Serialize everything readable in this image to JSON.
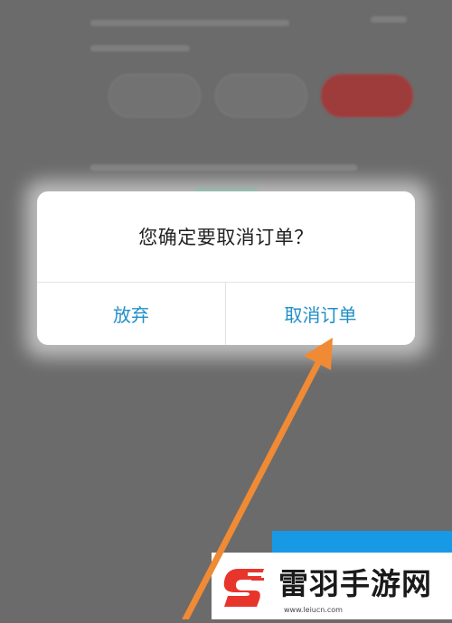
{
  "dialog": {
    "message": "您确定要取消订单？",
    "cancel_label": "放弃",
    "confirm_label": "取消订单"
  },
  "watermark": {
    "title": "雷羽手游网",
    "url": "www.leiucn.com"
  },
  "colors": {
    "accent": "#1f8fc7",
    "overlay": "#6b6b6b",
    "arrow": "#f08a34",
    "watermark_blue": "#1799e6",
    "logo_red": "#e8352b"
  }
}
